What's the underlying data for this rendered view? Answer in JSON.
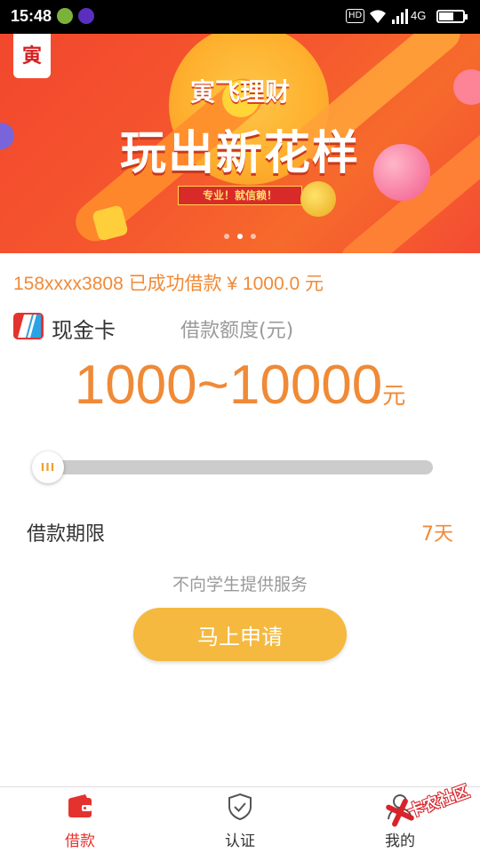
{
  "status_bar": {
    "time": "15:48",
    "hd_label": "HD",
    "network": "4G",
    "battery_level": 0.6
  },
  "banner": {
    "logo_text": "寅",
    "headline_1": "寅飞理财",
    "headline_2": "玩出新花样",
    "ribbon_text": "专业！就信赖！",
    "slides_total": 3,
    "active_slide": 2
  },
  "notice": {
    "text": "158xxxx3808 已成功借款 ¥ 1000.0 元"
  },
  "product": {
    "name": "现金卡",
    "limit_label": "借款额度(元)",
    "amount_range": "1000~10000",
    "amount_unit": "元"
  },
  "slider": {
    "value": 0,
    "handle_glyph": "III"
  },
  "term": {
    "label": "借款期限",
    "value": "7天"
  },
  "student_notice": "不向学生提供服务",
  "apply_button": {
    "label": "马上申请"
  },
  "bottom_nav": {
    "items": [
      {
        "label": "借款",
        "icon": "wallet-icon",
        "active": true
      },
      {
        "label": "认证",
        "icon": "shield-check-icon",
        "active": false
      },
      {
        "label": "我的",
        "icon": "person-icon",
        "active": false
      }
    ]
  },
  "watermark": {
    "text": "卡农社区"
  },
  "colors": {
    "accent_orange": "#ef8a37",
    "button_yellow": "#f5b93f",
    "nav_active_red": "#e4332f",
    "banner_red": "#f2472d"
  }
}
